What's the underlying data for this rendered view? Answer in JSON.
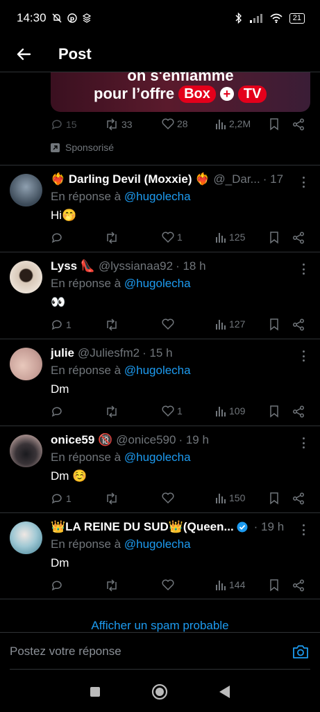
{
  "status_bar": {
    "time": "14:30",
    "battery": "21"
  },
  "header": {
    "title": "Post"
  },
  "ad": {
    "line1": "on s'enflamme",
    "line2_prefix": "pour l’offre",
    "pill_box": "Box",
    "pill_plus": "+",
    "pill_tv": "TV",
    "replies": "15",
    "reposts": "33",
    "likes": "28",
    "views": "2,2M",
    "sponsored_label": "Sponsorisé"
  },
  "in_reply_prefix": "En réponse à",
  "replies": [
    {
      "name": "❤️‍🔥 Darling Devil (Moxxie) ❤️‍🔥",
      "handle": "@_Dar...",
      "time": "· 17 h",
      "mention": "@hugolecha",
      "text": "Hi🤭",
      "reply_count": "",
      "repost_count": "",
      "like_count": "1",
      "views": "125",
      "avatar_color": "#5a6a7a"
    },
    {
      "name": "Lyss 👠",
      "handle": "@lyssianaa92",
      "time": "· 18 h",
      "mention": "@hugolecha",
      "text": "👀",
      "reply_count": "1",
      "repost_count": "",
      "like_count": "",
      "views": "127",
      "avatar_color": "#c8b8a8"
    },
    {
      "name": "julie",
      "handle": "@Juliesfm2",
      "time": "· 15 h",
      "mention": "@hugolecha",
      "text": "Dm",
      "reply_count": "",
      "repost_count": "",
      "like_count": "1",
      "views": "109",
      "avatar_color": "#d9b2a8"
    },
    {
      "name": "onice59 🔞",
      "handle": "@onice590",
      "time": "· 19 h",
      "mention": "@hugolecha",
      "text": "Dm ☺️",
      "reply_count": "1",
      "repost_count": "",
      "like_count": "",
      "views": "150",
      "avatar_color": "#8a7a7a"
    },
    {
      "name": "👑LA REINE DU SUD👑(Queen...",
      "handle": "",
      "time": "· 19 h",
      "mention": "@hugolecha",
      "text": "Dm",
      "reply_count": "",
      "repost_count": "",
      "like_count": "",
      "views": "144",
      "avatar_color": "#7fb8c8"
    }
  ],
  "spam_link": "Afficher un spam probable",
  "compose": {
    "placeholder": "Postez votre réponse"
  },
  "colors": {
    "accent": "#1d9bf0",
    "muted": "#71767b",
    "divider": "#2f3336"
  }
}
